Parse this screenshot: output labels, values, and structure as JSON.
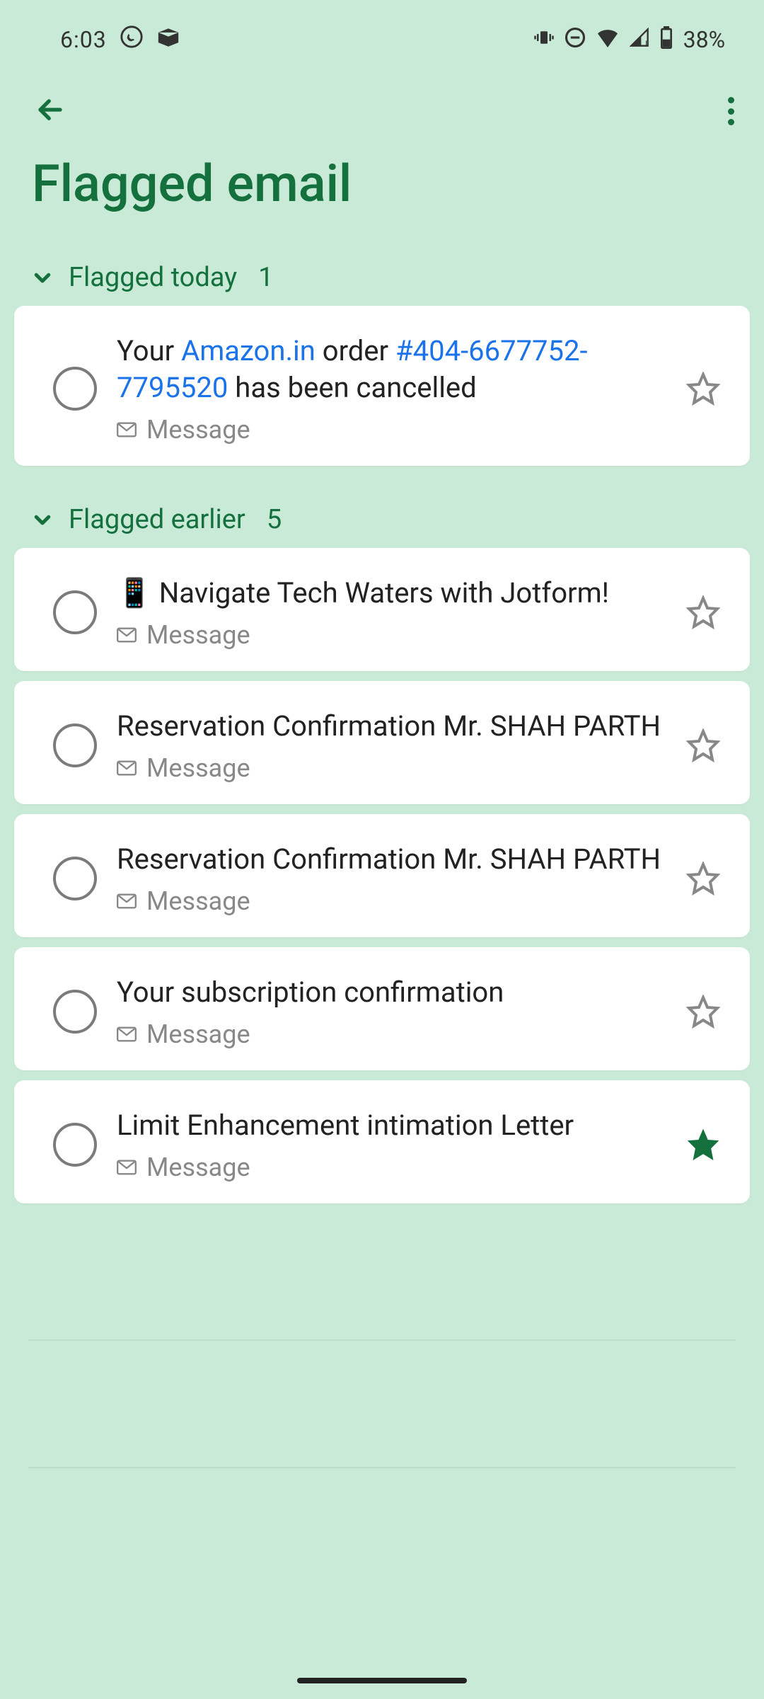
{
  "status_bar": {
    "time": "6:03",
    "battery": "38%"
  },
  "header": {
    "title": "Flagged email"
  },
  "sections": [
    {
      "label": "Flagged today",
      "count": "1"
    },
    {
      "label": "Flagged earlier",
      "count": "5"
    }
  ],
  "today_items": [
    {
      "title_pre": "Your ",
      "title_link1": "Amazon.in",
      "title_mid": " order ",
      "title_link2": "#404-6677752-7795520",
      "title_post": " has been cancelled",
      "meta": "Message",
      "starred": false
    }
  ],
  "earlier_items": [
    {
      "title": "📱 Navigate Tech Waters with Jotform!",
      "meta": "Message",
      "starred": false
    },
    {
      "title": "Reservation Confirmation  Mr. SHAH PARTH",
      "meta": "Message",
      "starred": false
    },
    {
      "title": "Reservation Confirmation Mr. SHAH PARTH",
      "meta": "Message",
      "starred": false
    },
    {
      "title": "Your subscription confirmation",
      "meta": "Message",
      "starred": false
    },
    {
      "title": "Limit Enhancement intimation Letter",
      "meta": "Message",
      "starred": true
    }
  ]
}
